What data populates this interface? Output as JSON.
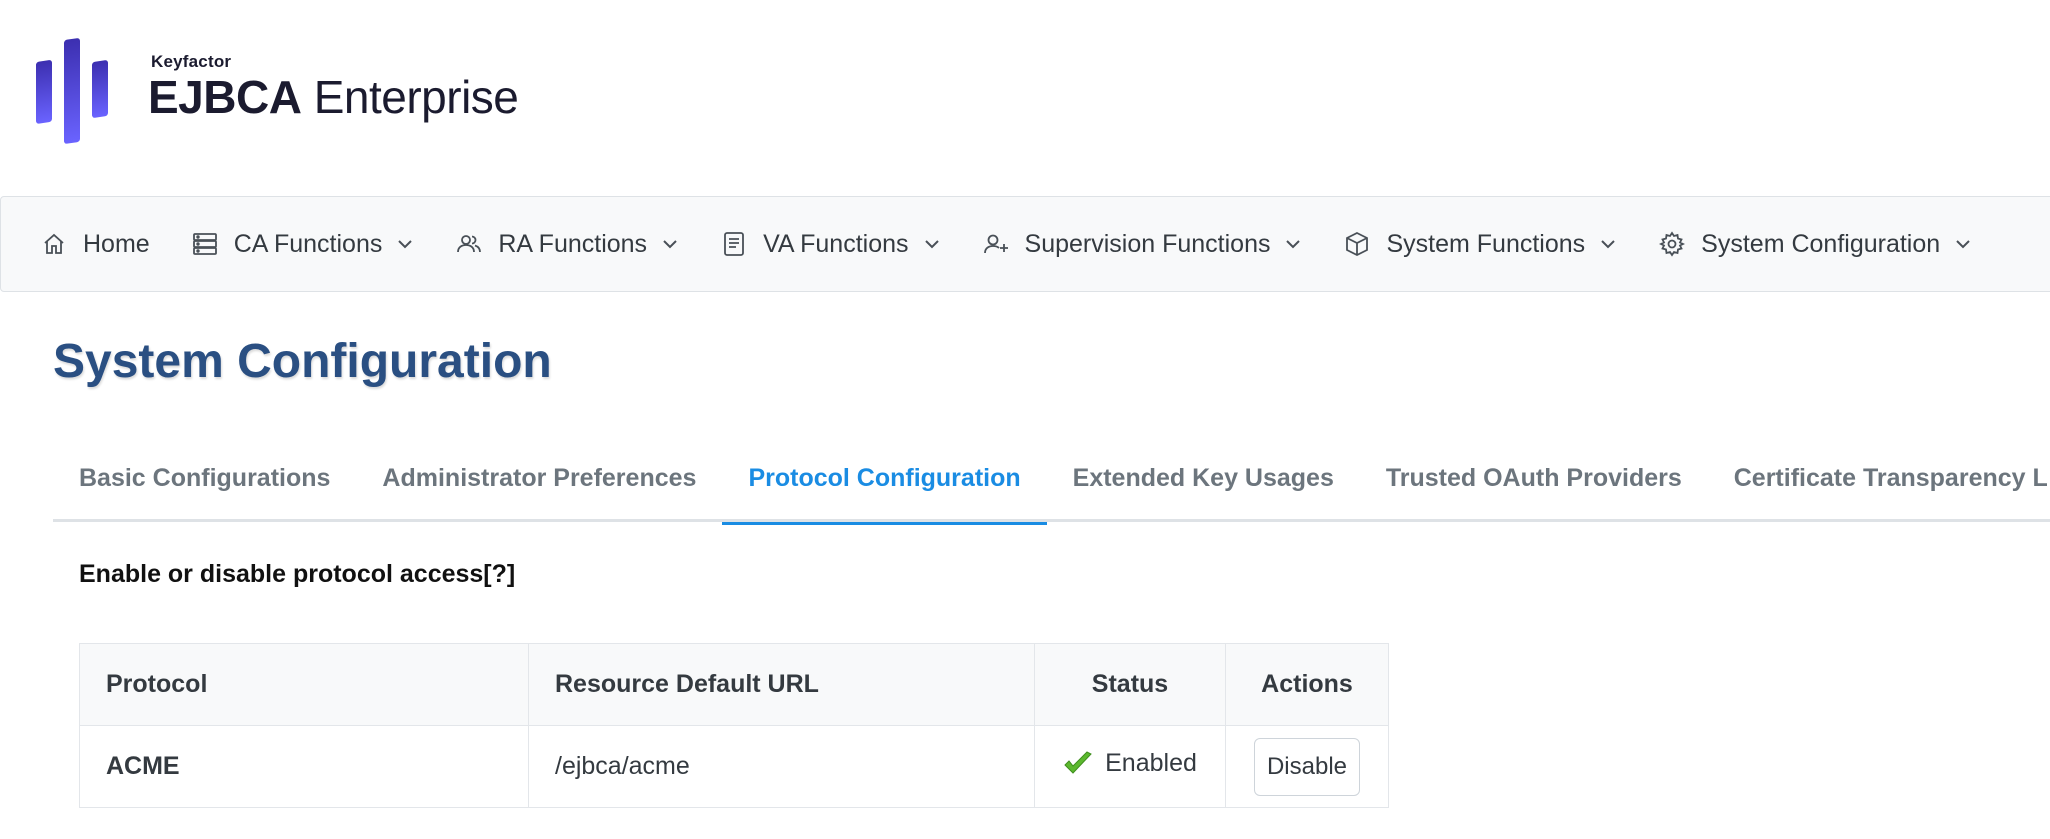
{
  "brand": {
    "company": "Keyfactor",
    "product_bold": "EJBCA",
    "product_light": "Enterprise",
    "accent_color": "#5b5bf0"
  },
  "nav": {
    "items": [
      {
        "label": "Home",
        "icon": "home-icon",
        "has_dropdown": false
      },
      {
        "label": "CA Functions",
        "icon": "server-icon",
        "has_dropdown": true
      },
      {
        "label": "RA Functions",
        "icon": "users-icon",
        "has_dropdown": true
      },
      {
        "label": "VA Functions",
        "icon": "document-icon",
        "has_dropdown": true
      },
      {
        "label": "Supervision Functions",
        "icon": "user-plus-icon",
        "has_dropdown": true
      },
      {
        "label": "System Functions",
        "icon": "cube-icon",
        "has_dropdown": true
      },
      {
        "label": "System Configuration",
        "icon": "gear-icon",
        "has_dropdown": true
      }
    ]
  },
  "page": {
    "title": "System Configuration"
  },
  "tabs": [
    {
      "label": "Basic Configurations",
      "active": false
    },
    {
      "label": "Administrator Preferences",
      "active": false
    },
    {
      "label": "Protocol Configuration",
      "active": true
    },
    {
      "label": "Extended Key Usages",
      "active": false
    },
    {
      "label": "Trusted OAuth Providers",
      "active": false
    },
    {
      "label": "Certificate Transparency L",
      "active": false
    }
  ],
  "section": {
    "heading": "Enable or disable protocol access[?]"
  },
  "table": {
    "headers": {
      "protocol": "Protocol",
      "url": "Resource Default URL",
      "status": "Status",
      "actions": "Actions"
    },
    "rows": [
      {
        "protocol": "ACME",
        "url": "/ejbca/acme",
        "status": "Enabled",
        "action": "Disable"
      }
    ]
  },
  "colors": {
    "title": "#2a4f82",
    "active_tab": "#1a8ce3",
    "enabled_check": "#5cb82e"
  }
}
